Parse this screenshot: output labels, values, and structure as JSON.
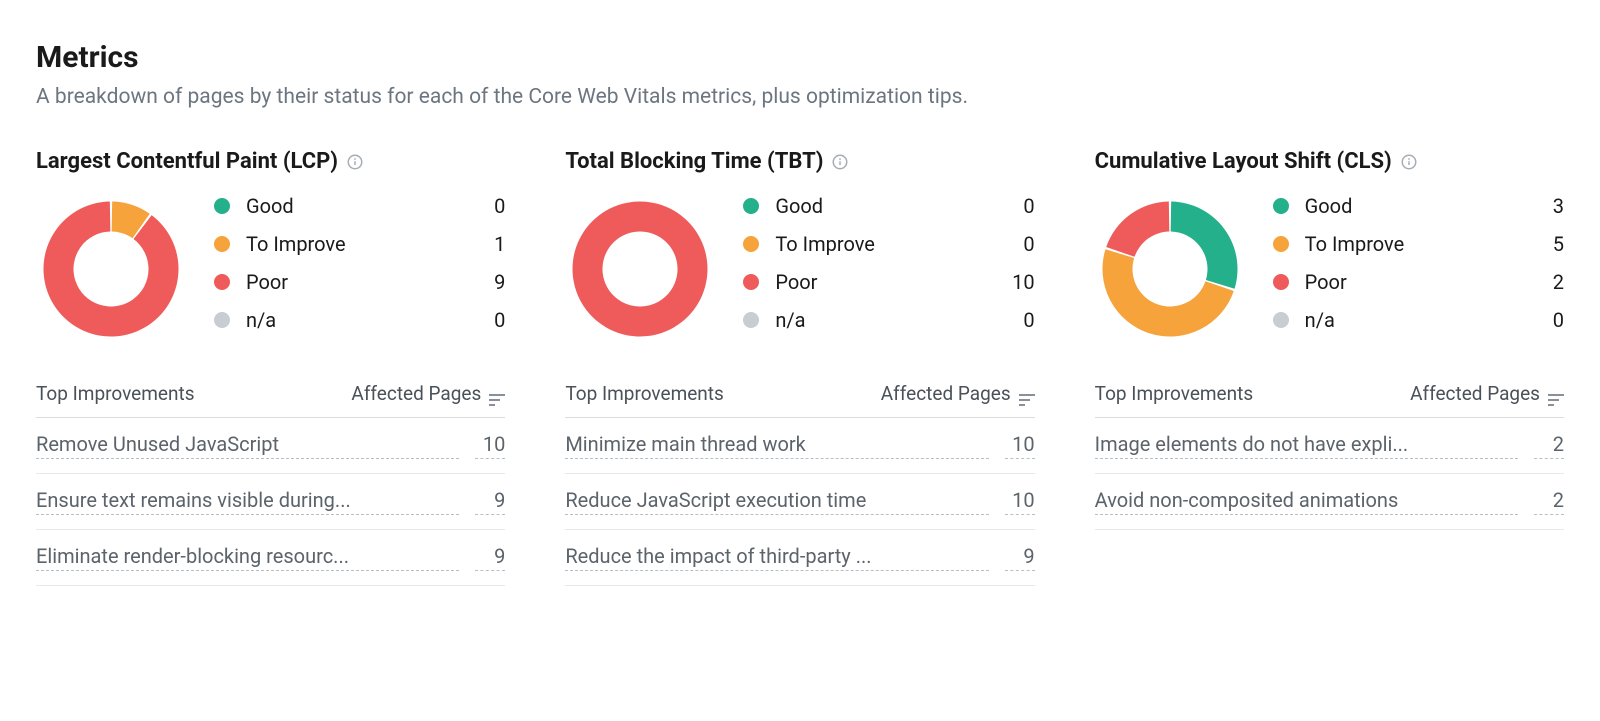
{
  "colors": {
    "good": "#25b08c",
    "improve": "#f5a33a",
    "poor": "#ef5b5b",
    "na": "#c7cdd3"
  },
  "header": {
    "title": "Metrics",
    "subtitle": "A breakdown of pages by their status for each of the Core Web Vitals metrics, plus optimization tips."
  },
  "legend_labels": {
    "good": "Good",
    "improve": "To Improve",
    "poor": "Poor",
    "na": "n/a"
  },
  "table_headers": {
    "improvements": "Top Improvements",
    "affected": "Affected Pages"
  },
  "metrics": [
    {
      "title": "Largest Contentful Paint (LCP)",
      "values": {
        "good": 0,
        "improve": 1,
        "poor": 9,
        "na": 0
      },
      "improvements": [
        {
          "label": "Remove Unused JavaScript",
          "count": 10
        },
        {
          "label": "Ensure text remains visible during...",
          "count": 9
        },
        {
          "label": "Eliminate render-blocking resourc...",
          "count": 9
        }
      ]
    },
    {
      "title": "Total Blocking Time (TBT)",
      "values": {
        "good": 0,
        "improve": 0,
        "poor": 10,
        "na": 0
      },
      "improvements": [
        {
          "label": "Minimize main thread work",
          "count": 10
        },
        {
          "label": "Reduce JavaScript execution time",
          "count": 10
        },
        {
          "label": "Reduce the impact of third-party ...",
          "count": 9
        }
      ]
    },
    {
      "title": "Cumulative Layout Shift (CLS)",
      "values": {
        "good": 3,
        "improve": 5,
        "poor": 2,
        "na": 0
      },
      "improvements": [
        {
          "label": "Image elements do not have expli...",
          "count": 2
        },
        {
          "label": "Avoid non-composited animations",
          "count": 2
        }
      ]
    }
  ],
  "chart_data": [
    {
      "type": "pie",
      "title": "Largest Contentful Paint (LCP)",
      "categories": [
        "Good",
        "To Improve",
        "Poor",
        "n/a"
      ],
      "values": [
        0,
        1,
        9,
        0
      ]
    },
    {
      "type": "pie",
      "title": "Total Blocking Time (TBT)",
      "categories": [
        "Good",
        "To Improve",
        "Poor",
        "n/a"
      ],
      "values": [
        0,
        0,
        10,
        0
      ]
    },
    {
      "type": "pie",
      "title": "Cumulative Layout Shift (CLS)",
      "categories": [
        "Good",
        "To Improve",
        "Poor",
        "n/a"
      ],
      "values": [
        3,
        5,
        2,
        0
      ]
    }
  ]
}
